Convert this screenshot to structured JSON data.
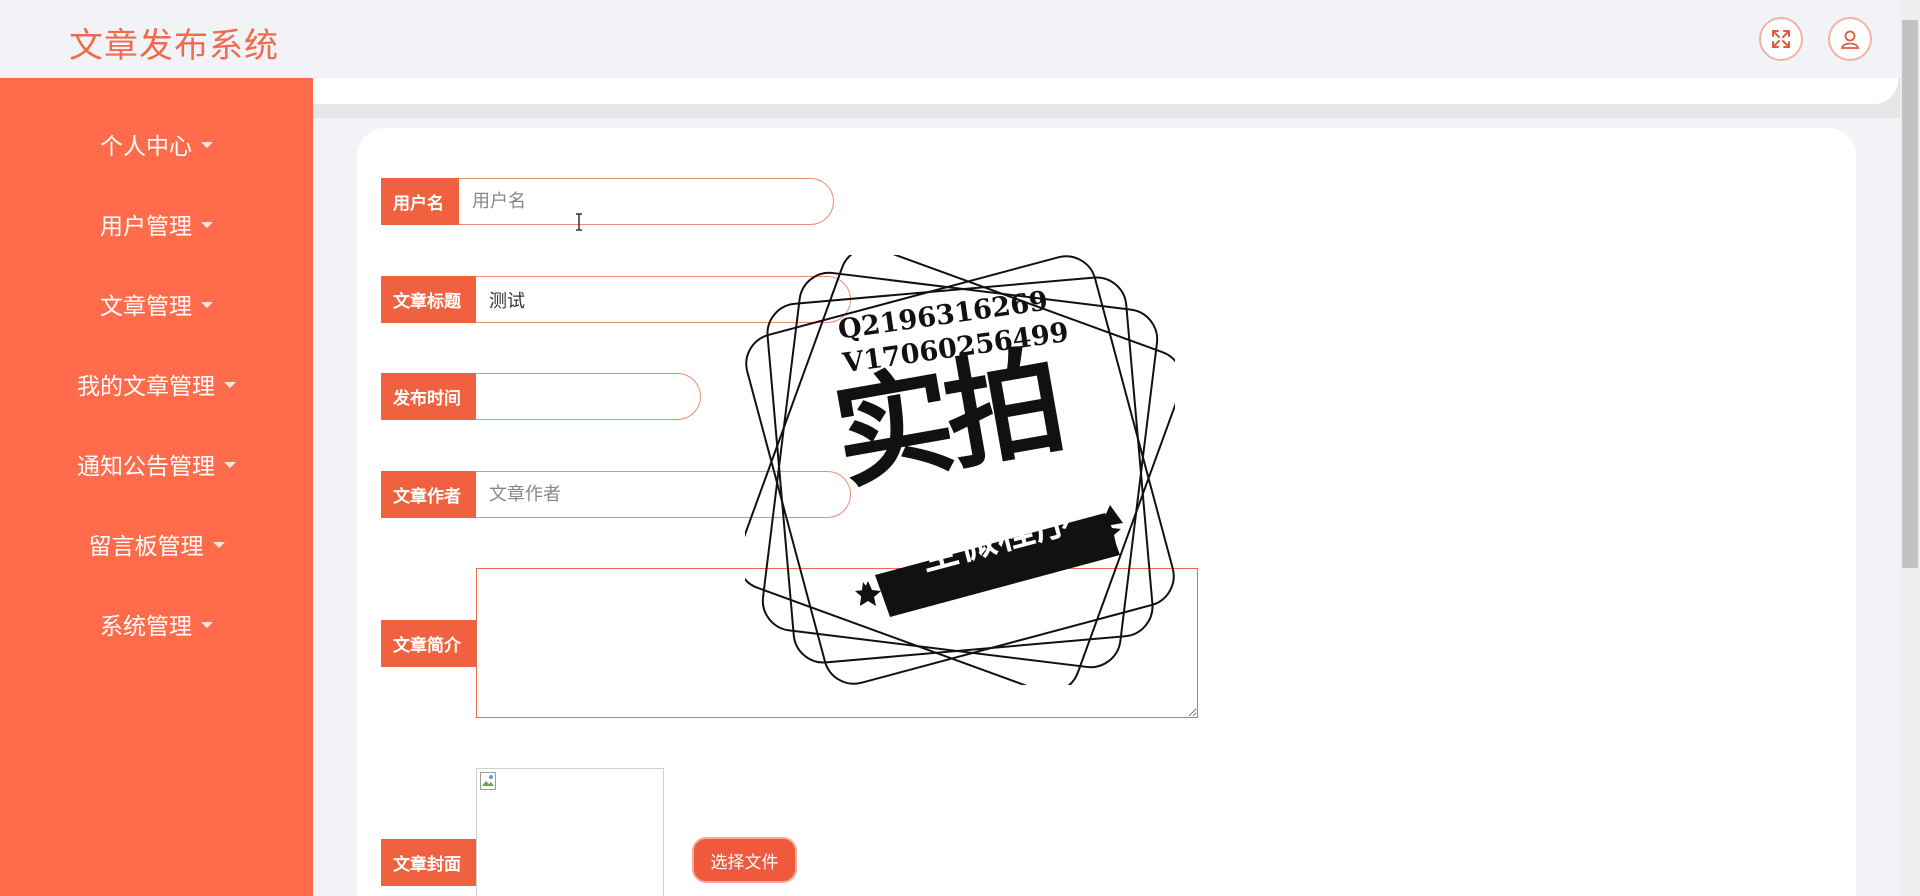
{
  "header": {
    "title": "文章发布系统",
    "fullscreen_icon": "expand-icon",
    "user_icon": "user-icon"
  },
  "sidebar": {
    "items": [
      {
        "label": "个人中心"
      },
      {
        "label": "用户管理"
      },
      {
        "label": "文章管理"
      },
      {
        "label": "我的文章管理"
      },
      {
        "label": "通知公告管理"
      },
      {
        "label": "留言板管理"
      },
      {
        "label": "系统管理"
      }
    ]
  },
  "form": {
    "username": {
      "label": "用户名",
      "value": "",
      "placeholder": "用户名"
    },
    "article_title": {
      "label": "文章标题",
      "value": "测试",
      "placeholder": ""
    },
    "publish_time": {
      "label": "发布时间",
      "value": "",
      "placeholder": ""
    },
    "article_author": {
      "label": "文章作者",
      "value": "",
      "placeholder": "文章作者"
    },
    "article_summary": {
      "label": "文章简介",
      "value": ""
    },
    "article_cover": {
      "label": "文章封面",
      "button_label": "选择文件"
    }
  },
  "watermark": {
    "line1": "Q2196316269",
    "line2": "V17060256499",
    "main": "实拍",
    "ribbon": "全微程序"
  },
  "colors": {
    "accent": "#ff6b4b",
    "title": "#ee6b4d",
    "label_bg": "#f0623f",
    "background": "#f2f3f7"
  }
}
